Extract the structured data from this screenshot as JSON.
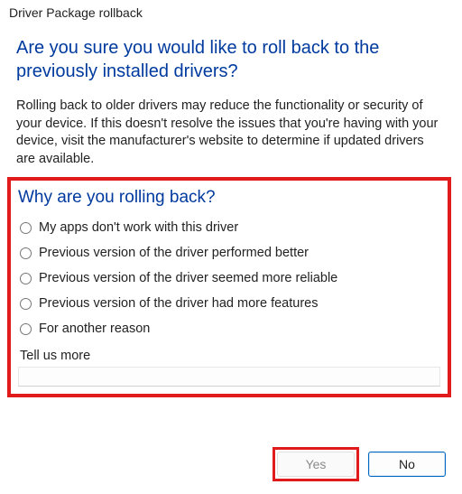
{
  "window": {
    "title": "Driver Package rollback"
  },
  "heading": "Are you sure you would like to roll back to the previously installed drivers?",
  "description": "Rolling back to older drivers may reduce the functionality or security of your device. If this doesn't resolve the issues that you're having with your device, visit the manufacturer's website to determine if updated drivers are available.",
  "subheading": "Why are you rolling back?",
  "reasons": [
    "My apps don't work with this driver",
    "Previous version of the driver performed better",
    "Previous version of the driver seemed more reliable",
    "Previous version of the driver had more features",
    "For another reason"
  ],
  "tell_more_label": "Tell us more",
  "tell_more_value": "",
  "buttons": {
    "yes": "Yes",
    "no": "No"
  }
}
